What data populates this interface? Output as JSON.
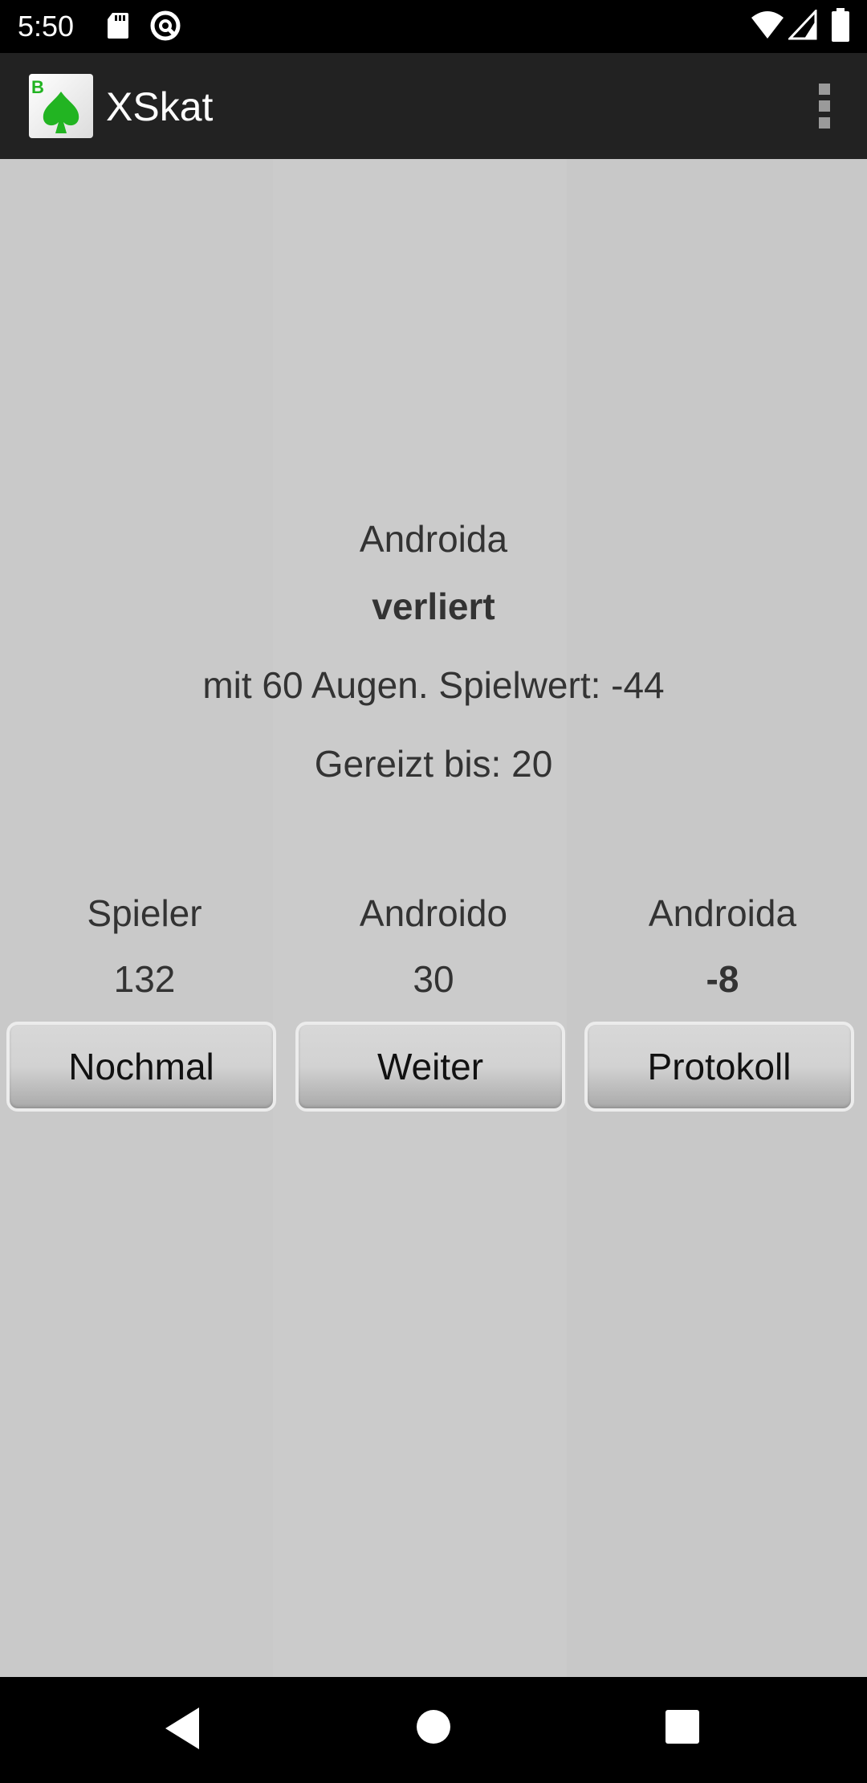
{
  "status_bar": {
    "time": "5:50",
    "left_icons": [
      "sd-card-icon",
      "vpn-key-icon"
    ],
    "right_icons": [
      "wifi-icon",
      "signal-icon",
      "battery-icon"
    ]
  },
  "app_bar": {
    "title": "XSkat",
    "logo_icon": "spade-logo-icon",
    "menu_icon": "overflow-menu-icon"
  },
  "result": {
    "player": "Androida",
    "outcome": "verliert",
    "details": "mit 60 Augen. Spielwert: -44",
    "bid": "Gereizt bis: 20"
  },
  "scores": {
    "players": [
      {
        "name": "Spieler",
        "score": "132"
      },
      {
        "name": "Androido",
        "score": "30"
      },
      {
        "name": "Androida",
        "score": "-8"
      }
    ]
  },
  "buttons": {
    "again": "Nochmal",
    "next": "Weiter",
    "log": "Protokoll"
  },
  "nav_bar": {
    "icons": [
      "back-icon",
      "home-icon",
      "recents-icon"
    ]
  },
  "colors": {
    "background": "#c9c9c9",
    "app_bar": "#222222",
    "text": "#333333",
    "logo_green": "#22b422"
  }
}
